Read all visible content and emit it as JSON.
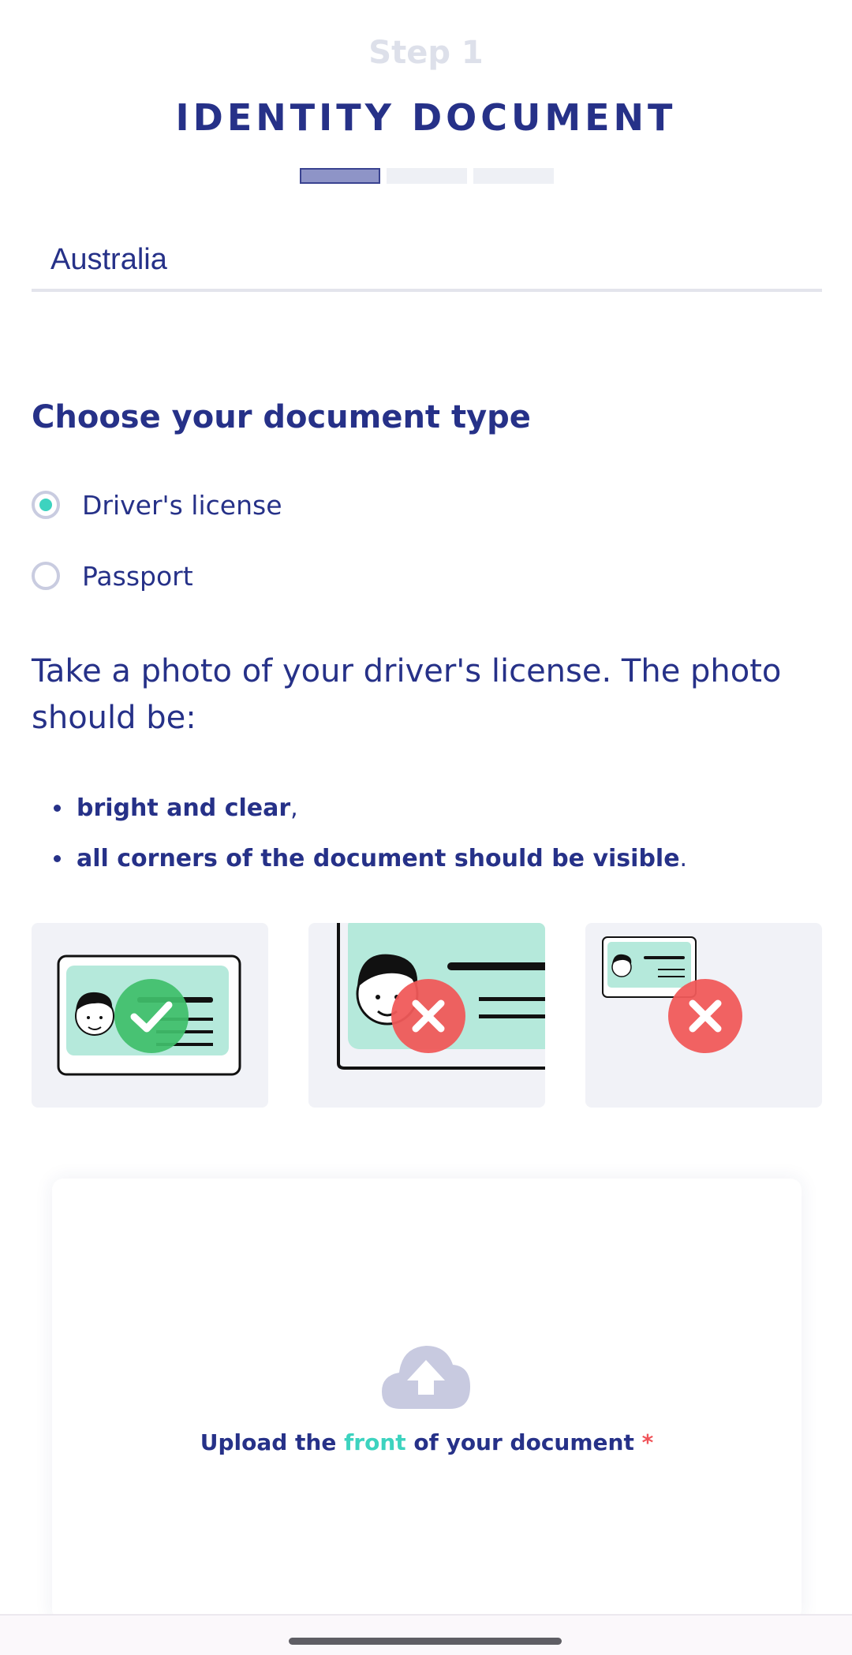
{
  "header": {
    "step_label": "Step 1",
    "title": "IDENTITY DOCUMENT",
    "progress_current": 1,
    "progress_total": 3
  },
  "country": {
    "value": "Australia"
  },
  "document_type": {
    "heading": "Choose your document type",
    "options": [
      {
        "label": "Driver's license",
        "selected": true
      },
      {
        "label": "Passport",
        "selected": false
      }
    ]
  },
  "instructions": {
    "text": "Take a photo of your driver's license. The photo should be:",
    "bullets": [
      {
        "bold": "bright and clear",
        "tail": ","
      },
      {
        "bold": "all corners of the document should be visible",
        "tail": "."
      }
    ]
  },
  "examples": [
    {
      "status": "good",
      "icon": "check-icon"
    },
    {
      "status": "bad",
      "icon": "cross-icon"
    },
    {
      "status": "bad",
      "icon": "cross-icon"
    }
  ],
  "upload": {
    "prefix": "Upload the ",
    "accent": "front",
    "suffix": " of your document ",
    "required_mark": "*",
    "icon": "cloud-upload-icon"
  },
  "colors": {
    "primary": "#263188",
    "accent": "#3dd3bf",
    "success": "#3fbe6a",
    "error": "#f05a5a",
    "card_bg": "#b5e9db"
  }
}
